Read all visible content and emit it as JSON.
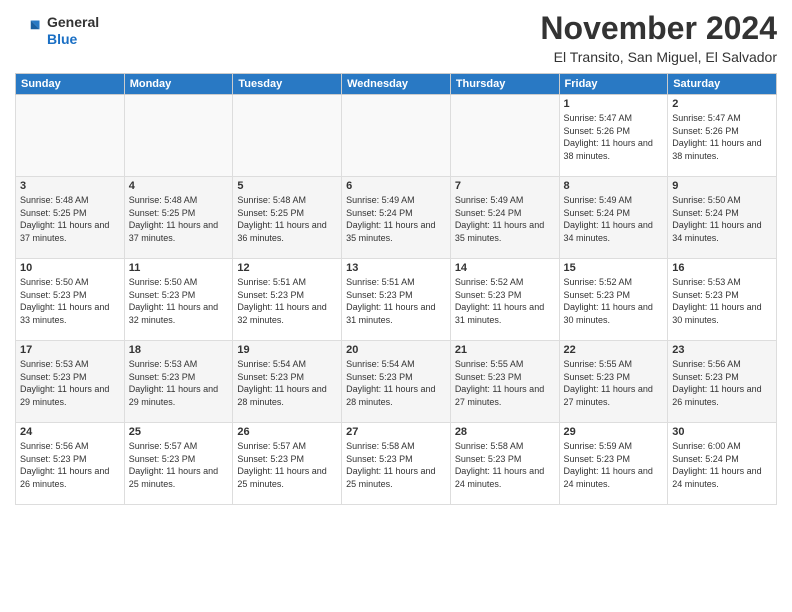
{
  "logo": {
    "general": "General",
    "blue": "Blue"
  },
  "title": "November 2024",
  "subtitle": "El Transito, San Miguel, El Salvador",
  "days_header": [
    "Sunday",
    "Monday",
    "Tuesday",
    "Wednesday",
    "Thursday",
    "Friday",
    "Saturday"
  ],
  "weeks": [
    [
      {
        "day": "",
        "info": ""
      },
      {
        "day": "",
        "info": ""
      },
      {
        "day": "",
        "info": ""
      },
      {
        "day": "",
        "info": ""
      },
      {
        "day": "",
        "info": ""
      },
      {
        "day": "1",
        "info": "Sunrise: 5:47 AM\nSunset: 5:26 PM\nDaylight: 11 hours\nand 38 minutes."
      },
      {
        "day": "2",
        "info": "Sunrise: 5:47 AM\nSunset: 5:26 PM\nDaylight: 11 hours\nand 38 minutes."
      }
    ],
    [
      {
        "day": "3",
        "info": "Sunrise: 5:48 AM\nSunset: 5:25 PM\nDaylight: 11 hours\nand 37 minutes."
      },
      {
        "day": "4",
        "info": "Sunrise: 5:48 AM\nSunset: 5:25 PM\nDaylight: 11 hours\nand 37 minutes."
      },
      {
        "day": "5",
        "info": "Sunrise: 5:48 AM\nSunset: 5:25 PM\nDaylight: 11 hours\nand 36 minutes."
      },
      {
        "day": "6",
        "info": "Sunrise: 5:49 AM\nSunset: 5:24 PM\nDaylight: 11 hours\nand 35 minutes."
      },
      {
        "day": "7",
        "info": "Sunrise: 5:49 AM\nSunset: 5:24 PM\nDaylight: 11 hours\nand 35 minutes."
      },
      {
        "day": "8",
        "info": "Sunrise: 5:49 AM\nSunset: 5:24 PM\nDaylight: 11 hours\nand 34 minutes."
      },
      {
        "day": "9",
        "info": "Sunrise: 5:50 AM\nSunset: 5:24 PM\nDaylight: 11 hours\nand 34 minutes."
      }
    ],
    [
      {
        "day": "10",
        "info": "Sunrise: 5:50 AM\nSunset: 5:23 PM\nDaylight: 11 hours\nand 33 minutes."
      },
      {
        "day": "11",
        "info": "Sunrise: 5:50 AM\nSunset: 5:23 PM\nDaylight: 11 hours\nand 32 minutes."
      },
      {
        "day": "12",
        "info": "Sunrise: 5:51 AM\nSunset: 5:23 PM\nDaylight: 11 hours\nand 32 minutes."
      },
      {
        "day": "13",
        "info": "Sunrise: 5:51 AM\nSunset: 5:23 PM\nDaylight: 11 hours\nand 31 minutes."
      },
      {
        "day": "14",
        "info": "Sunrise: 5:52 AM\nSunset: 5:23 PM\nDaylight: 11 hours\nand 31 minutes."
      },
      {
        "day": "15",
        "info": "Sunrise: 5:52 AM\nSunset: 5:23 PM\nDaylight: 11 hours\nand 30 minutes."
      },
      {
        "day": "16",
        "info": "Sunrise: 5:53 AM\nSunset: 5:23 PM\nDaylight: 11 hours\nand 30 minutes."
      }
    ],
    [
      {
        "day": "17",
        "info": "Sunrise: 5:53 AM\nSunset: 5:23 PM\nDaylight: 11 hours\nand 29 minutes."
      },
      {
        "day": "18",
        "info": "Sunrise: 5:53 AM\nSunset: 5:23 PM\nDaylight: 11 hours\nand 29 minutes."
      },
      {
        "day": "19",
        "info": "Sunrise: 5:54 AM\nSunset: 5:23 PM\nDaylight: 11 hours\nand 28 minutes."
      },
      {
        "day": "20",
        "info": "Sunrise: 5:54 AM\nSunset: 5:23 PM\nDaylight: 11 hours\nand 28 minutes."
      },
      {
        "day": "21",
        "info": "Sunrise: 5:55 AM\nSunset: 5:23 PM\nDaylight: 11 hours\nand 27 minutes."
      },
      {
        "day": "22",
        "info": "Sunrise: 5:55 AM\nSunset: 5:23 PM\nDaylight: 11 hours\nand 27 minutes."
      },
      {
        "day": "23",
        "info": "Sunrise: 5:56 AM\nSunset: 5:23 PM\nDaylight: 11 hours\nand 26 minutes."
      }
    ],
    [
      {
        "day": "24",
        "info": "Sunrise: 5:56 AM\nSunset: 5:23 PM\nDaylight: 11 hours\nand 26 minutes."
      },
      {
        "day": "25",
        "info": "Sunrise: 5:57 AM\nSunset: 5:23 PM\nDaylight: 11 hours\nand 25 minutes."
      },
      {
        "day": "26",
        "info": "Sunrise: 5:57 AM\nSunset: 5:23 PM\nDaylight: 11 hours\nand 25 minutes."
      },
      {
        "day": "27",
        "info": "Sunrise: 5:58 AM\nSunset: 5:23 PM\nDaylight: 11 hours\nand 25 minutes."
      },
      {
        "day": "28",
        "info": "Sunrise: 5:58 AM\nSunset: 5:23 PM\nDaylight: 11 hours\nand 24 minutes."
      },
      {
        "day": "29",
        "info": "Sunrise: 5:59 AM\nSunset: 5:23 PM\nDaylight: 11 hours\nand 24 minutes."
      },
      {
        "day": "30",
        "info": "Sunrise: 6:00 AM\nSunset: 5:24 PM\nDaylight: 11 hours\nand 24 minutes."
      }
    ]
  ]
}
